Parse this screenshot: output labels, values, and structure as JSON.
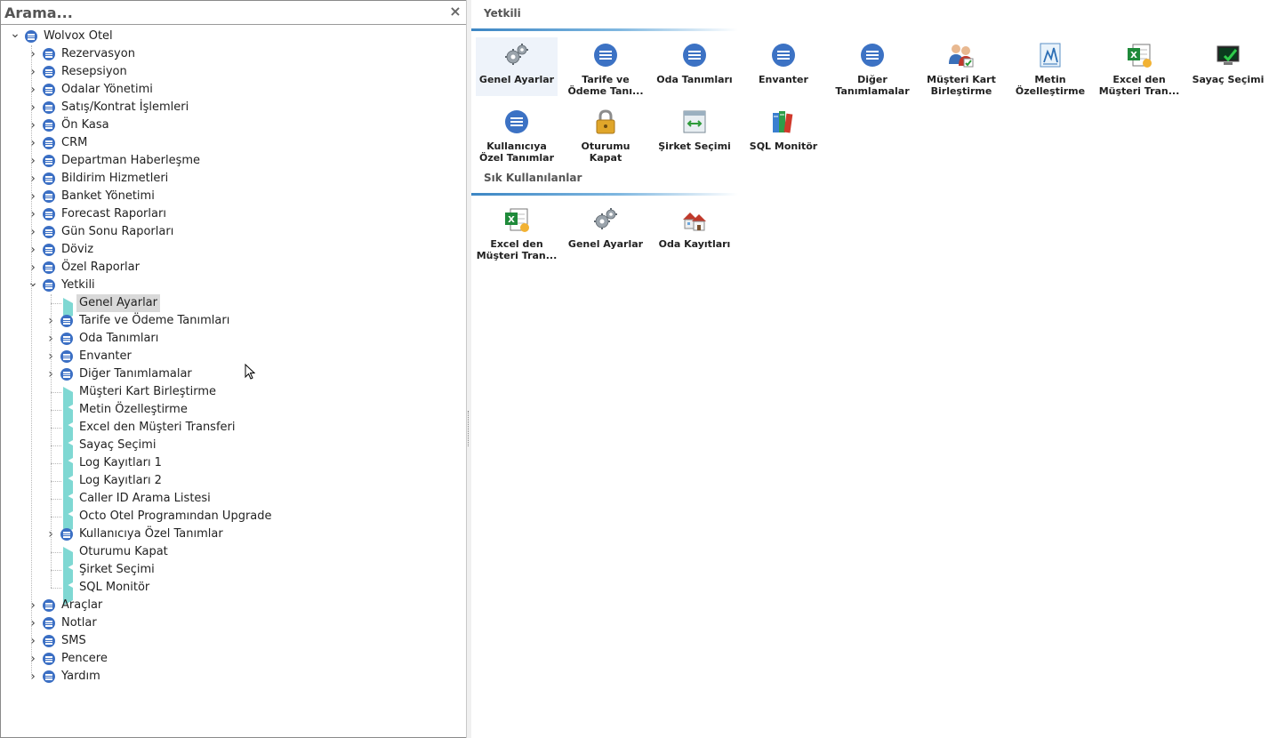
{
  "search": {
    "placeholder": "Arama..."
  },
  "tree": [
    {
      "label": "Wolvox Otel",
      "level": 0,
      "type": "folder",
      "expanded": true
    },
    {
      "label": "Rezervasyon",
      "level": 1,
      "type": "folder",
      "expanded": false
    },
    {
      "label": "Resepsiyon",
      "level": 1,
      "type": "folder",
      "expanded": false
    },
    {
      "label": "Odalar Yönetimi",
      "level": 1,
      "type": "folder",
      "expanded": false
    },
    {
      "label": "Satış/Kontrat İşlemleri",
      "level": 1,
      "type": "folder",
      "expanded": false
    },
    {
      "label": "Ön Kasa",
      "level": 1,
      "type": "folder",
      "expanded": false
    },
    {
      "label": "CRM",
      "level": 1,
      "type": "folder",
      "expanded": false
    },
    {
      "label": "Departman Haberleşme",
      "level": 1,
      "type": "folder",
      "expanded": false
    },
    {
      "label": "Bildirim Hizmetleri",
      "level": 1,
      "type": "folder",
      "expanded": false
    },
    {
      "label": "Banket Yönetimi",
      "level": 1,
      "type": "folder",
      "expanded": false
    },
    {
      "label": "Forecast Raporları",
      "level": 1,
      "type": "folder",
      "expanded": false
    },
    {
      "label": "Gün Sonu Raporları",
      "level": 1,
      "type": "folder",
      "expanded": false
    },
    {
      "label": "Döviz",
      "level": 1,
      "type": "folder",
      "expanded": false
    },
    {
      "label": "Özel Raporlar",
      "level": 1,
      "type": "folder",
      "expanded": false
    },
    {
      "label": "Yetkili",
      "level": 1,
      "type": "folder",
      "expanded": true
    },
    {
      "label": "Genel Ayarlar",
      "level": 2,
      "type": "leaf",
      "selected": true
    },
    {
      "label": "Tarife ve Ödeme Tanımları",
      "level": 2,
      "type": "folder",
      "expanded": false
    },
    {
      "label": "Oda Tanımları",
      "level": 2,
      "type": "folder",
      "expanded": false
    },
    {
      "label": "Envanter",
      "level": 2,
      "type": "folder",
      "expanded": false
    },
    {
      "label": "Diğer Tanımlamalar",
      "level": 2,
      "type": "folder",
      "expanded": false
    },
    {
      "label": "Müşteri Kart Birleştirme",
      "level": 2,
      "type": "leaf"
    },
    {
      "label": "Metin Özelleştirme",
      "level": 2,
      "type": "leaf"
    },
    {
      "label": "Excel den Müşteri Transferi",
      "level": 2,
      "type": "leaf"
    },
    {
      "label": "Sayaç Seçimi",
      "level": 2,
      "type": "leaf"
    },
    {
      "label": "Log Kayıtları 1",
      "level": 2,
      "type": "leaf"
    },
    {
      "label": "Log Kayıtları 2",
      "level": 2,
      "type": "leaf"
    },
    {
      "label": "Caller ID Arama Listesi",
      "level": 2,
      "type": "leaf"
    },
    {
      "label": "Octo Otel Programından Upgrade",
      "level": 2,
      "type": "leaf"
    },
    {
      "label": "Kullanıcıya Özel Tanımlar",
      "level": 2,
      "type": "folder",
      "expanded": false
    },
    {
      "label": "Oturumu Kapat",
      "level": 2,
      "type": "leaf"
    },
    {
      "label": "Şirket Seçimi",
      "level": 2,
      "type": "leaf"
    },
    {
      "label": "SQL Monitör",
      "level": 2,
      "type": "leaf"
    },
    {
      "label": "Araçlar",
      "level": 1,
      "type": "folder",
      "expanded": false
    },
    {
      "label": "Notlar",
      "level": 1,
      "type": "folder",
      "expanded": false
    },
    {
      "label": "SMS",
      "level": 1,
      "type": "folder",
      "expanded": false
    },
    {
      "label": "Pencere",
      "level": 1,
      "type": "folder",
      "expanded": false
    },
    {
      "label": "Yardım",
      "level": 1,
      "type": "folder",
      "expanded": false
    }
  ],
  "groups": [
    {
      "title": "Yetkili",
      "tiles": [
        {
          "label": "Genel Ayarlar",
          "icon": "gears-icon",
          "highlighted": true
        },
        {
          "label": "Tarife ve Ödeme Tanı...",
          "icon": "menu-circle-icon"
        },
        {
          "label": "Oda Tanımları",
          "icon": "menu-circle-icon"
        },
        {
          "label": "Envanter",
          "icon": "menu-circle-icon"
        },
        {
          "label": "Diğer Tanımlamalar",
          "icon": "menu-circle-icon"
        },
        {
          "label": "Müşteri Kart Birleştirme",
          "icon": "users-merge-icon"
        },
        {
          "label": "Metin Özelleştirme",
          "icon": "text-chart-icon"
        },
        {
          "label": "Excel den Müşteri Tran...",
          "icon": "excel-icon"
        },
        {
          "label": "Sayaç Seçimi",
          "icon": "monitor-check-icon"
        },
        {
          "label": "Kullanıcıya Özel Tanımlar",
          "icon": "menu-circle-icon"
        },
        {
          "label": "Oturumu Kapat",
          "icon": "padlock-icon"
        },
        {
          "label": "Şirket Seçimi",
          "icon": "switch-window-icon"
        },
        {
          "label": "SQL Monitör",
          "icon": "books-icon"
        }
      ]
    },
    {
      "title": "Sık Kullanılanlar",
      "tiles": [
        {
          "label": "Excel den Müşteri Tran...",
          "icon": "excel-icon"
        },
        {
          "label": "Genel Ayarlar",
          "icon": "gears-icon"
        },
        {
          "label": "Oda Kayıtları",
          "icon": "houses-icon"
        }
      ]
    }
  ],
  "colors": {
    "accent": "#3c72c4",
    "leaf": "#7fd8d3",
    "selection": "#d9d9d9",
    "group_line": "#3c86c4"
  }
}
